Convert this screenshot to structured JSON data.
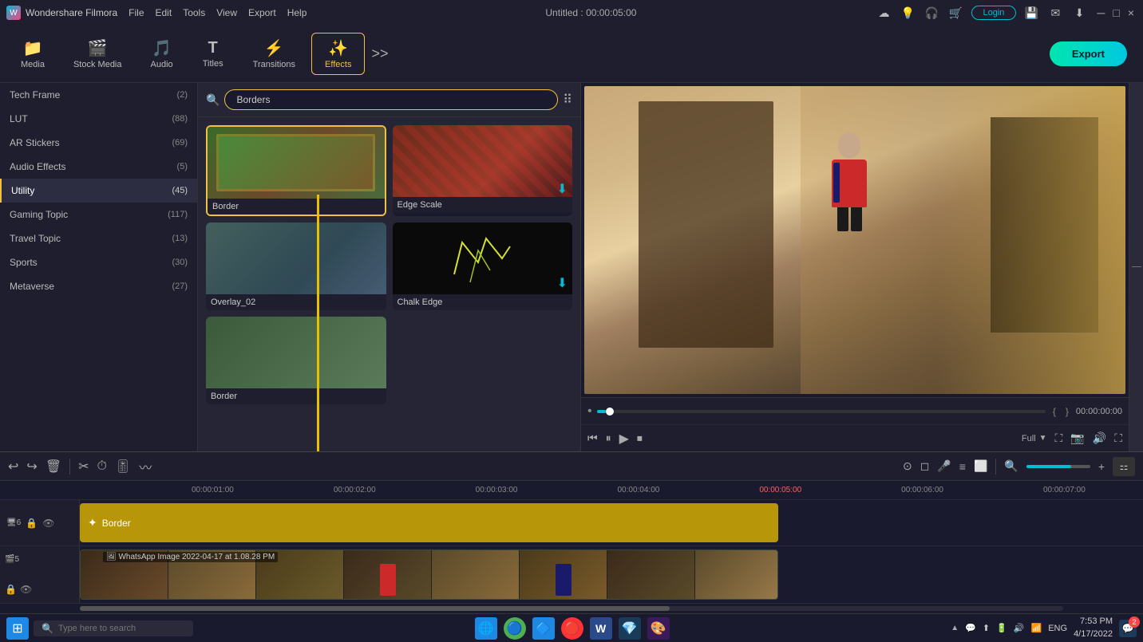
{
  "app": {
    "name": "Wondershare Filmora",
    "logo": "W",
    "title": "Untitled : 00:00:05:00",
    "version": "Filmora"
  },
  "titlebar": {
    "menus": [
      "File",
      "Edit",
      "Tools",
      "View",
      "Export",
      "Help"
    ],
    "icons": [
      "cloud",
      "bulb",
      "headset",
      "cart"
    ],
    "login_label": "Login",
    "window_controls": [
      "─",
      "□",
      "×"
    ]
  },
  "toolbar": {
    "items": [
      {
        "id": "media",
        "icon": "📁",
        "label": "Media"
      },
      {
        "id": "stock",
        "icon": "🎬",
        "label": "Stock Media"
      },
      {
        "id": "audio",
        "icon": "🎵",
        "label": "Audio"
      },
      {
        "id": "titles",
        "icon": "T",
        "label": "Titles"
      },
      {
        "id": "transitions",
        "icon": "⚡",
        "label": "Transitions"
      },
      {
        "id": "effects",
        "icon": "✨",
        "label": "Effects",
        "active": true
      }
    ],
    "more_label": ">>",
    "export_label": "Export"
  },
  "sidebar": {
    "items": [
      {
        "label": "Tech Frame",
        "count": 2
      },
      {
        "label": "LUT",
        "count": 88
      },
      {
        "label": "AR Stickers",
        "count": 69
      },
      {
        "label": "Audio Effects",
        "count": 5
      },
      {
        "label": "Utility",
        "count": 45,
        "active": true
      },
      {
        "label": "Gaming Topic",
        "count": 117
      },
      {
        "label": "Travel Topic",
        "count": 13
      },
      {
        "label": "Sports",
        "count": 30
      },
      {
        "label": "Metaverse",
        "count": 27
      }
    ]
  },
  "effects": {
    "search_placeholder": "Borders",
    "search_value": "Borders",
    "items": [
      {
        "id": "border",
        "label": "Border",
        "color1": "#4a7a3a",
        "color2": "#7a3a2a",
        "selected": true
      },
      {
        "id": "edge_scale",
        "label": "Edge Scale",
        "color1": "#5a2a1a",
        "color2": "#8a3a2a",
        "has_download": true
      },
      {
        "id": "overlay_02",
        "label": "Overlay_02",
        "color1": "#3a4a5a",
        "color2": "#5a6a7a"
      },
      {
        "id": "chalk_edge",
        "label": "Chalk Edge",
        "color1": "#1a1a1a",
        "color2": "#2a3a2a",
        "has_download": true
      },
      {
        "id": "border2",
        "label": "Border",
        "color1": "#3a5a3a",
        "color2": "#5a7a5a"
      }
    ]
  },
  "preview": {
    "time_current": "00:00:00:00",
    "time_total": "00:00:05:00",
    "quality": "Full",
    "slider_position": 0
  },
  "timeline": {
    "toolbar_buttons": [
      "undo",
      "redo",
      "delete",
      "cut",
      "speed",
      "equalizer",
      "waveform"
    ],
    "zoom_level": "100%",
    "timecodes": [
      "00:00:01:00",
      "00:00:02:00",
      "00:00:03:00",
      "00:00:04:00",
      "00:00:05:00",
      "00:00:06:00",
      "00:00:07:00"
    ],
    "tracks": [
      {
        "id": 6,
        "type": "effect",
        "icons": [
          "lock",
          "eye"
        ],
        "clip_label": "Border",
        "clip_color": "#b8960a"
      },
      {
        "id": 5,
        "type": "video",
        "icons": [
          "camera",
          "lock",
          "eye"
        ],
        "clip_label": "WhatsApp Image 2022-04-17 at 1.08.28 PM",
        "clip_color": "#2a3a2a"
      }
    ]
  },
  "taskbar": {
    "search_placeholder": "Type here to search",
    "apps": [
      "🌐",
      "🔵",
      "🔵",
      "🔴",
      "W",
      "💎",
      "🎨"
    ],
    "sys_icons": [
      "▲",
      "💬",
      "⬆",
      "🔋",
      "🔊",
      "📶"
    ],
    "lang": "ENG",
    "time": "7:53 PM",
    "date": "4/17/2022",
    "notification_count": 2
  },
  "arrow": {
    "visible": true,
    "color": "#e8c000"
  }
}
